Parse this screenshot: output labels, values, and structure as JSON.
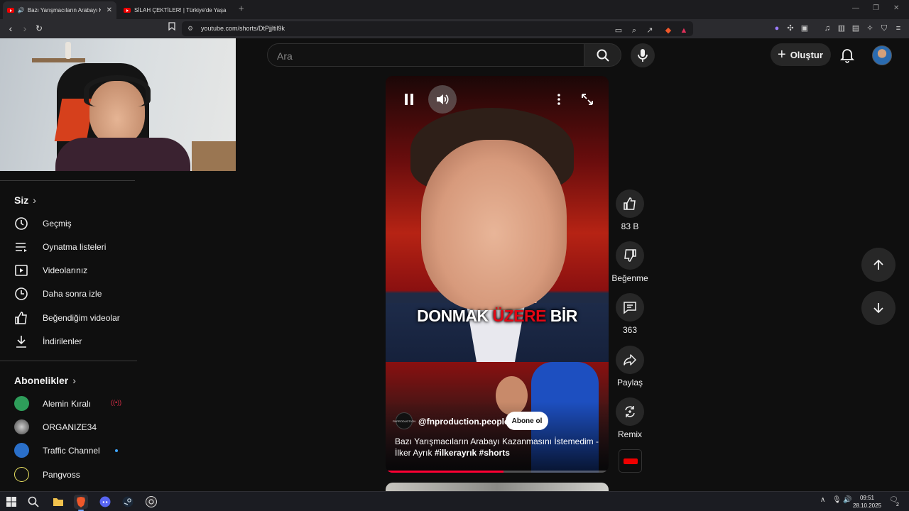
{
  "browser": {
    "tabs": [
      {
        "title": "Bazı Yarışmacıların Arabayı Ka",
        "active": true
      },
      {
        "title": "SİLAH ÇEKTİLER! | Türkiye'de Yaşanan",
        "active": false
      }
    ],
    "url": "youtube.com/shorts/DtPjjltil9k"
  },
  "header": {
    "search_placeholder": "Ara",
    "create_label": "Oluştur"
  },
  "sidebar": {
    "you_title": "Siz",
    "you_items": [
      {
        "label": "Geçmiş",
        "icon": "history-icon"
      },
      {
        "label": "Oynatma listeleri",
        "icon": "playlist-icon"
      },
      {
        "label": "Videolarınız",
        "icon": "your-videos-icon"
      },
      {
        "label": "Daha sonra izle",
        "icon": "watch-later-icon"
      },
      {
        "label": "Beğendiğim videolar",
        "icon": "liked-videos-icon"
      },
      {
        "label": "İndirilenler",
        "icon": "downloads-icon"
      }
    ],
    "subs_title": "Abonelikler",
    "subscriptions": [
      {
        "name": "Alemin Kıralı",
        "live": true
      },
      {
        "name": "ORGANIZE34",
        "new": false
      },
      {
        "name": "Traffic Channel",
        "new": true
      },
      {
        "name": "Pangvoss",
        "new": false
      }
    ]
  },
  "video": {
    "caption_before": "DONMAK ",
    "caption_highlight": "ÜZERE",
    "caption_after": " BİR",
    "channel": "@fnproduction.people",
    "channel_avatar_text": "FNPRODUCTION",
    "subscribe_label": "Abone ol",
    "title": "Bazı Yarışmacıların Arabayı Kazanmasını İstemedim - İlker Ayrık",
    "tags": "#ilkerayrık #shorts",
    "progress": 0.53
  },
  "actions": {
    "likes": "83 B",
    "dislike_label": "Beğenme",
    "comments": "363",
    "share_label": "Paylaş",
    "remix_label": "Remix"
  },
  "taskbar": {
    "time": "09:51",
    "date": "28.10.2025",
    "notifications": "2"
  },
  "colors": {
    "accent_red": "#ff0033",
    "link_blue": "#3ea6ff",
    "background": "#0f0f0f"
  }
}
